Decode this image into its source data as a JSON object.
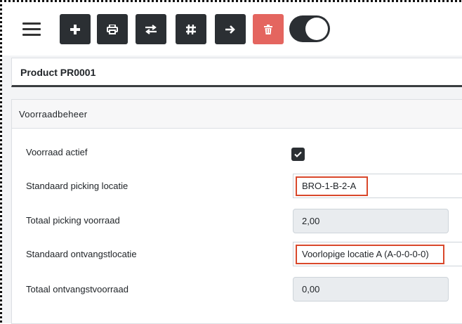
{
  "toolbar": {
    "menu_icon": "hamburger-icon",
    "buttons": [
      {
        "icon": "plus-icon",
        "glyph": "+"
      },
      {
        "icon": "print-icon",
        "glyph": "⎙"
      },
      {
        "icon": "swap-icon",
        "glyph": "⇄"
      },
      {
        "icon": "hash-icon",
        "glyph": "#"
      },
      {
        "icon": "arrow-right-icon",
        "glyph": "➔"
      },
      {
        "icon": "trash-icon",
        "glyph": "🗑"
      }
    ],
    "toggle_state": "on"
  },
  "product": {
    "title": "Product PR0001"
  },
  "stock": {
    "header": "Voorraadbeheer",
    "fields": {
      "active_label": "Voorraad actief",
      "active_checked": true,
      "picking_location_label": "Standaard picking locatie",
      "picking_location_value": "BRO-1-B-2-A",
      "picking_stock_label": "Totaal picking voorraad",
      "picking_stock_value": "2,00",
      "receiving_location_label": "Standaard ontvangstlocatie",
      "receiving_location_value": "Voorlopige locatie A (A-0-0-0-0)",
      "receiving_stock_label": "Totaal ontvangstvoorraad",
      "receiving_stock_value": "0,00"
    }
  },
  "colors": {
    "dark_button": "#2b2f33",
    "danger_button": "#e4655f",
    "highlight": "#d9482b"
  }
}
